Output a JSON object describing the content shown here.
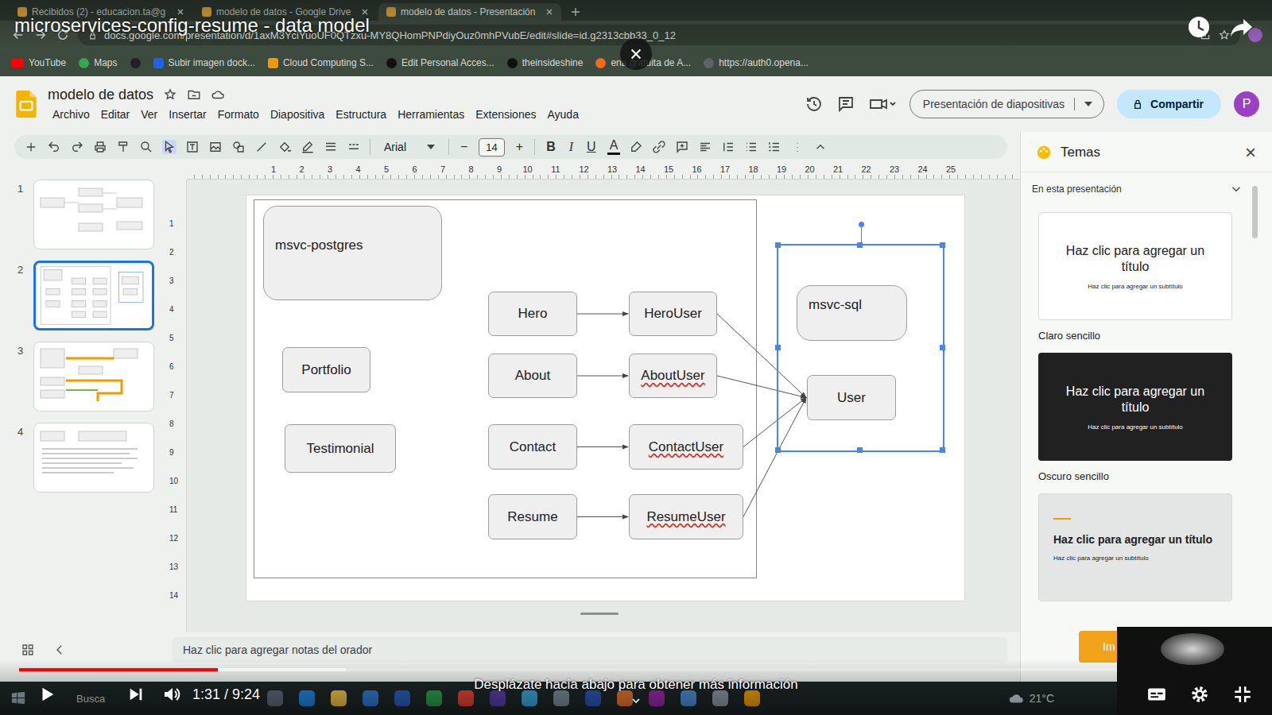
{
  "video": {
    "title": "microservices-config-resume - data model",
    "time": "1:31 / 9:24",
    "progress": 0.161,
    "buffered": 0.265,
    "paused": true,
    "hint": "Desplázate hacia abajo para obtener más información"
  },
  "browser": {
    "tabs": [
      {
        "label": "Recibidos (2) - educacion.ta@g",
        "selected": false
      },
      {
        "label": "modelo de datos - Google Drive",
        "selected": false
      },
      {
        "label": "modelo de datos - Presentación",
        "selected": true
      }
    ],
    "url": "docs.google.com/presentation/d/1axM3YciYuoUF0QTzxu-MY8QHomPNPdiyOuz0mhPVubE/edit#slide=id.g2313cbb33_0_12",
    "bookmarks": [
      {
        "label": "YouTube",
        "kind": "youtube"
      },
      {
        "label": "Maps",
        "kind": "maps"
      },
      {
        "kind": "dark"
      },
      {
        "label": "Subir imagen dock...",
        "kind": "docker"
      },
      {
        "label": "Cloud Computing S...",
        "kind": "cloud"
      },
      {
        "label": "Edit Personal Acces...",
        "kind": "github"
      },
      {
        "label": "theinsideshine",
        "kind": "github"
      },
      {
        "label": "ena gratuita de A...",
        "kind": "orange"
      },
      {
        "label": "https://auth0.opena...",
        "kind": "globe"
      }
    ]
  },
  "slides": {
    "title": "modelo de datos",
    "menus": [
      "Archivo",
      "Editar",
      "Ver",
      "Insertar",
      "Formato",
      "Diapositiva",
      "Estructura",
      "Herramientas",
      "Extensiones",
      "Ayuda"
    ],
    "present": "Presentación de diapositivas",
    "share": "Compartir",
    "avatar": "P"
  },
  "toolbar": {
    "font": "Arial",
    "minus": "−",
    "size": "14",
    "plus": "+",
    "bold": "B",
    "italic": "I",
    "underline": "U",
    "textColor": "A"
  },
  "ruler": {
    "horizontal": [
      "1",
      "2",
      "3",
      "4",
      "5",
      "6",
      "7",
      "8",
      "9",
      "10",
      "11",
      "12",
      "13",
      "14",
      "15",
      "16",
      "17",
      "18",
      "19",
      "20",
      "21",
      "22",
      "23",
      "24",
      "25"
    ],
    "vertical": [
      "1",
      "2",
      "3",
      "4",
      "5",
      "6",
      "7",
      "8",
      "9",
      "10",
      "11",
      "12",
      "13",
      "14"
    ]
  },
  "filmstrip": [
    {
      "number": "1",
      "selected": false
    },
    {
      "number": "2",
      "selected": true
    },
    {
      "number": "3",
      "selected": false
    },
    {
      "number": "4",
      "selected": false
    }
  ],
  "diagram": {
    "nodes": [
      {
        "label": "msvc-postgres",
        "kind": "container",
        "misspelled": false
      },
      {
        "label": "Portfolio",
        "kind": "entity",
        "misspelled": false
      },
      {
        "label": "Testimonial",
        "kind": "entity",
        "misspelled": false
      },
      {
        "label": "Hero",
        "kind": "entity",
        "misspelled": false
      },
      {
        "label": "About",
        "kind": "entity",
        "misspelled": false
      },
      {
        "label": "Contact",
        "kind": "entity",
        "misspelled": false
      },
      {
        "label": "Resume",
        "kind": "entity",
        "misspelled": false
      },
      {
        "label": "HeroUser",
        "kind": "entity",
        "misspelled": false
      },
      {
        "label": "AboutUser",
        "kind": "entity",
        "misspelled": true
      },
      {
        "label": "ContactUser",
        "kind": "entity",
        "misspelled": true
      },
      {
        "label": "ResumeUser",
        "kind": "entity",
        "misspelled": true
      },
      {
        "label": "msvc-sql",
        "kind": "container",
        "misspelled": false
      },
      {
        "label": "User",
        "kind": "entity",
        "misspelled": false
      }
    ],
    "edges": [
      {
        "from": "Hero",
        "to": "HeroUser"
      },
      {
        "from": "About",
        "to": "AboutUser"
      },
      {
        "from": "Contact",
        "to": "ContactUser"
      },
      {
        "from": "Resume",
        "to": "ResumeUser"
      },
      {
        "from": "HeroUser",
        "to": "User"
      },
      {
        "from": "AboutUser",
        "to": "User"
      },
      {
        "from": "ContactUser",
        "to": "User"
      },
      {
        "from": "ResumeUser",
        "to": "User"
      }
    ],
    "selection": {
      "selected": true
    }
  },
  "notes": "Haz clic para agregar notas del orador",
  "themes": {
    "title": "Temas",
    "close": "×",
    "filter": "En esta presentación",
    "cards": [
      {
        "kind": "light",
        "title": "Haz clic para agregar un título",
        "subtitle": "Haz clic para agregar un subtítulo",
        "label": "Claro sencillo"
      },
      {
        "kind": "dark",
        "title": "Haz clic para agregar un título",
        "subtitle": "Haz clic para agregar un subtítulo",
        "label": "Oscuro sencillo"
      },
      {
        "kind": "grey",
        "title": "Haz clic para agregar un título",
        "subtitle": "Haz clic para agregar un subtítulo"
      }
    ],
    "import": "Im"
  },
  "taskbar": {
    "search": "Busca",
    "weather": "21°C"
  }
}
